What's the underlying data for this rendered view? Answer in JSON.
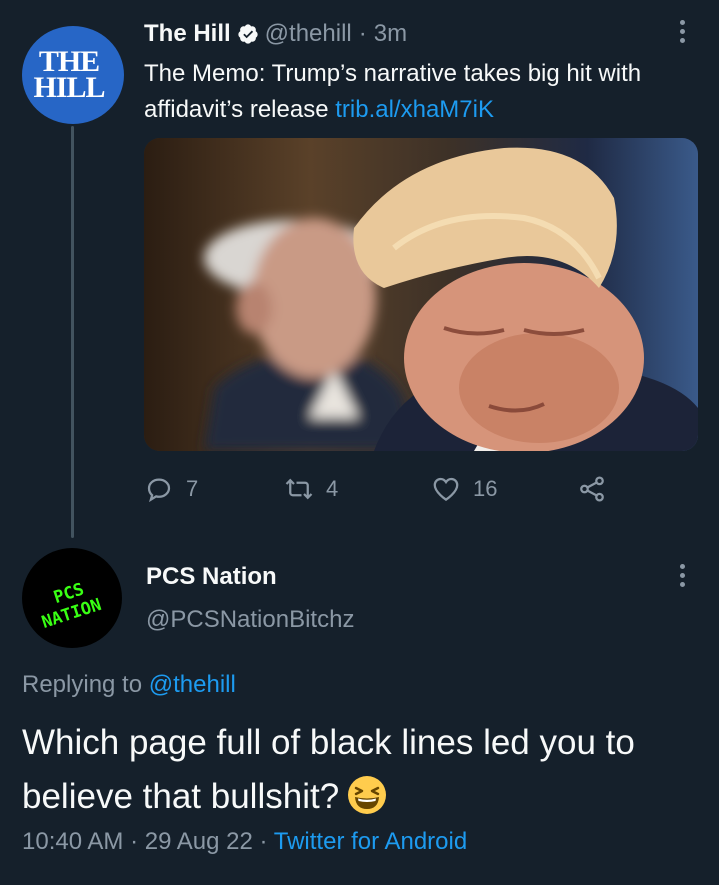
{
  "original_tweet": {
    "avatar_text_line1": "THE",
    "avatar_text_line2": "HILL",
    "author_name": "The Hill",
    "author_handle": "@thehill",
    "separator": "·",
    "time_ago": "3m",
    "text": "The Memo: Trump’s narrative takes big hit with affidavit’s release ",
    "link": "trib.al/xhaM7iK",
    "media_description_icon": "photo-two-men-icon",
    "actions": {
      "replies": "7",
      "retweets": "4",
      "likes": "16"
    }
  },
  "reply_tweet": {
    "avatar_text": "PCS NATION",
    "author_name": "PCS Nation",
    "author_handle": "@PCSNationBitchz",
    "replying_prefix": "Replying to ",
    "replying_to": "@thehill",
    "text": "Which page full of black lines led you to believe that bullshit?",
    "emoji": "😆",
    "time": "10:40 AM",
    "date": "29 Aug 22",
    "separator": "·",
    "source": "Twitter for Android"
  },
  "colors": {
    "background": "#15202b",
    "text_primary": "#f7f9f9",
    "text_secondary": "#8b98a5",
    "link": "#1d9bf0",
    "hill_blue": "#2766c6",
    "pcs_green": "#39ff14"
  }
}
